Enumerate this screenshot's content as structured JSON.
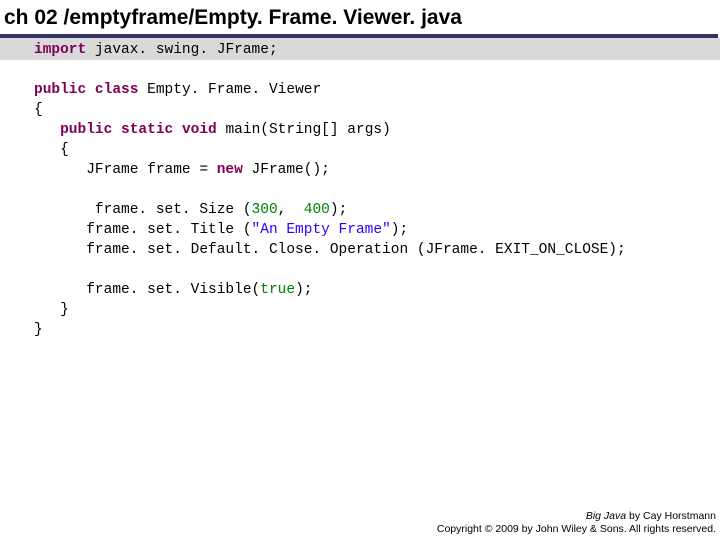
{
  "title": "ch 02 /emptyframe/Empty. Frame. Viewer. java",
  "code": {
    "kw_import": "import",
    "l1_rest": " javax. swing. JFrame;",
    "kw_public": "public",
    "kw_class": "class",
    "l3_classname": " Empty. Frame. Viewer",
    "l4": "{",
    "l5_indent": "   ",
    "kw_static": "static",
    "kw_void": "void",
    "l5_rest": " main(String[] args)",
    "l6": "   {",
    "l7_indent": "      JFrame frame = ",
    "kw_new": "new",
    "l7_rest": " JFrame();",
    "l9_indent": "       frame. set. Size (",
    "num300": "300",
    "comma_space": ",  ",
    "num400": "400",
    "l9_close": ");",
    "l10_indent": "      frame. set. Title (",
    "str_title": "\"An Empty Frame\"",
    "l10_close": ");",
    "l11": "      frame. set. Default. Close. Operation (JFrame. EXIT_ON_CLOSE);",
    "l13_indent": "      frame. set. Visible(",
    "bool_true": "true",
    "l13_close": ");",
    "l14": "   }",
    "l15": "}"
  },
  "footer": {
    "book": "Big Java",
    "author": " by Cay Horstmann",
    "copyright": "Copyright © 2009 by John Wiley & Sons.  All rights reserved."
  }
}
